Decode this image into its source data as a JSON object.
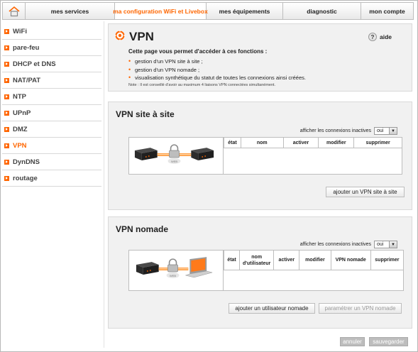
{
  "nav": {
    "tabs": [
      {
        "label": "mes services"
      },
      {
        "label": "ma configuration WiFi et Livebox"
      },
      {
        "label": "mes équipements"
      },
      {
        "label": "diagnostic"
      },
      {
        "label": "mon compte"
      }
    ],
    "active_tab": 1
  },
  "sidebar": {
    "items": [
      {
        "label": "WiFi"
      },
      {
        "label": "pare-feu"
      },
      {
        "label": "DHCP et DNS"
      },
      {
        "label": "NAT/PAT"
      },
      {
        "label": "NTP"
      },
      {
        "label": "UPnP"
      },
      {
        "label": "DMZ"
      },
      {
        "label": "VPN"
      },
      {
        "label": "DynDNS"
      },
      {
        "label": "routage"
      }
    ],
    "active_index": 7
  },
  "page": {
    "title": "VPN",
    "help_label": "aide",
    "intro_heading": "Cette page vous permet d'accéder à ces fonctions :",
    "intro_items": [
      "gestion d'un VPN site à site ;",
      "gestion d'un VPN nomade ;",
      "visualisation synthétique du statut de toutes les connexions ainsi créées."
    ],
    "note": "Note : Il est conseillé d'avoir au maximum 4 liaisons VPN connectées simultanément."
  },
  "site_to_site": {
    "title": "VPN site à site",
    "filter_label": "afficher les connexions inactives",
    "filter_value": "oui",
    "columns": [
      "état",
      "nom",
      "activer",
      "modifier",
      "supprimer"
    ],
    "add_button": "ajouter un VPN site à site"
  },
  "nomade": {
    "title": "VPN nomade",
    "filter_label": "afficher les connexions inactives",
    "filter_value": "oui",
    "columns": [
      "état",
      "nom\nd'utilisateur",
      "activer",
      "modifier",
      "VPN nomade",
      "supprimer"
    ],
    "add_button": "ajouter un utilisateur nomade",
    "config_button": "paramétrer un VPN nomade"
  },
  "footer": {
    "cancel_label": "annuler",
    "save_label": "sauvegarder"
  },
  "colors": {
    "accent": "#ff6600",
    "panel": "#f1f1f1"
  }
}
